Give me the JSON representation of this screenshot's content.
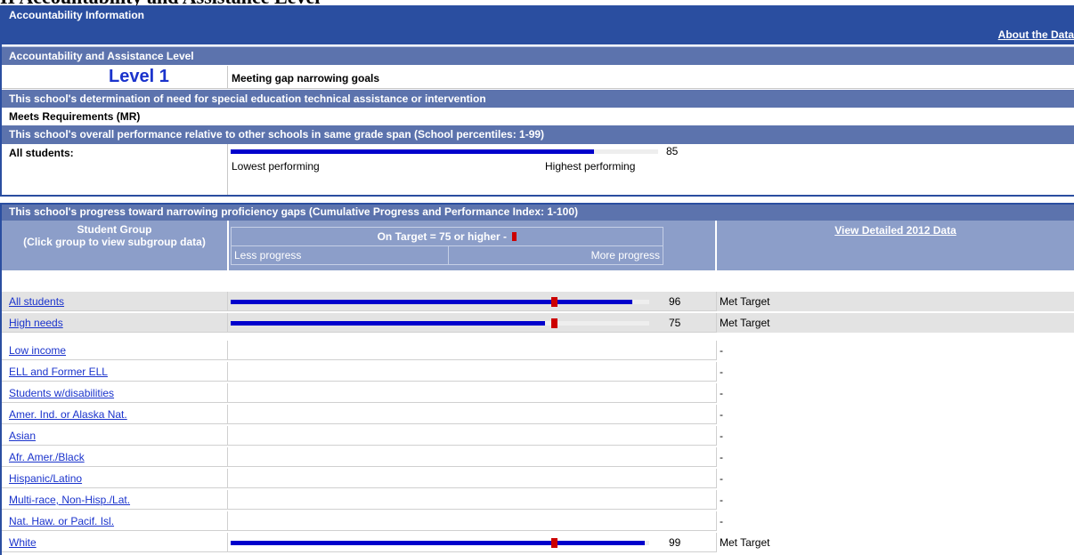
{
  "page_heading_partial": "II Accountability and Assistance Level",
  "panel1": {
    "title": "Accountability Information",
    "about_link": "About the Data",
    "level_section": "Accountability and Assistance Level",
    "level": "Level 1",
    "level_desc": "Meeting gap narrowing goals",
    "sped_section": "This school's determination of need for special education technical assistance or intervention",
    "sped_value": "Meets Requirements (MR)",
    "perf_section": "This school's overall performance relative to other schools in same grade span (School percentiles: 1-99)",
    "all_students_label": "All students:",
    "percentile": 85,
    "percentile_text": "85",
    "low_label": "Lowest performing",
    "high_label": "Highest performing"
  },
  "panel2": {
    "title": "This school's progress toward narrowing proficiency gaps (Cumulative Progress and Performance Index: 1-100)",
    "group_header": "Student Group\n(Click group to view subgroup data)",
    "target_header": "On Target = 75 or higher -",
    "less_label": "Less progress",
    "more_label": "More progress",
    "detail_link": "View Detailed 2012 Data",
    "target": 75,
    "groups": [
      {
        "name": "All students",
        "value": 96,
        "value_text": "96",
        "status": "Met Target",
        "shaded": true
      },
      {
        "name": "High needs",
        "value": 75,
        "value_text": "75",
        "status": "Met Target",
        "shaded": true
      },
      {
        "name": "Low income",
        "value": null,
        "value_text": "",
        "status": "-",
        "shaded": false
      },
      {
        "name": "ELL and Former ELL",
        "value": null,
        "value_text": "",
        "status": "-",
        "shaded": false
      },
      {
        "name": "Students w/disabilities",
        "value": null,
        "value_text": "",
        "status": "-",
        "shaded": false
      },
      {
        "name": "Amer. Ind. or Alaska Nat.",
        "value": null,
        "value_text": "",
        "status": "-",
        "shaded": false
      },
      {
        "name": "Asian",
        "value": null,
        "value_text": "",
        "status": "-",
        "shaded": false
      },
      {
        "name": "Afr. Amer./Black",
        "value": null,
        "value_text": "",
        "status": "-",
        "shaded": false
      },
      {
        "name": "Hispanic/Latino",
        "value": null,
        "value_text": "",
        "status": "-",
        "shaded": false
      },
      {
        "name": "Multi-race, Non-Hisp./Lat.",
        "value": null,
        "value_text": "",
        "status": "-",
        "shaded": false
      },
      {
        "name": "Nat. Haw. or Pacif. Isl.",
        "value": null,
        "value_text": "",
        "status": "-",
        "shaded": false
      },
      {
        "name": "White",
        "value": 99,
        "value_text": "99",
        "status": "Met Target",
        "shaded": false
      }
    ]
  },
  "colors": {
    "header_dark": "#2a4ea0",
    "header_mid": "#5c73ad",
    "bar_fill": "#0000cc",
    "target_marker": "#cc0000",
    "link": "#1a33cc"
  }
}
